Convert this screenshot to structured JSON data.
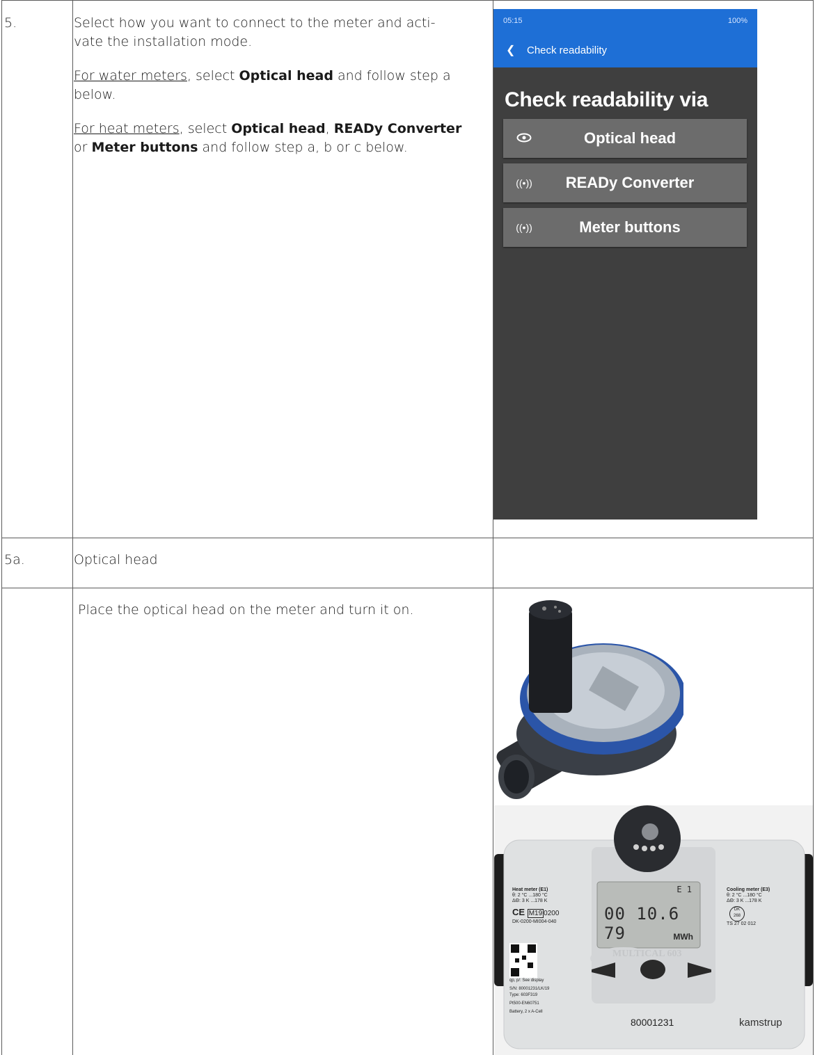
{
  "row5": {
    "number": "5.",
    "intro_line1": "Select how you want to connect to the meter and acti-",
    "intro_line2": "vate the installation mode.",
    "water": {
      "lead": "For water meters",
      "mid1": ", select ",
      "opt": "Optical head",
      "tail1": " and follow step a",
      "tail2": "below."
    },
    "heat": {
      "lead": "For heat meters",
      "mid1": ", select ",
      "opt1": "Optical head",
      "sep": ", ",
      "opt2": "READy Converter",
      "or": "or ",
      "opt3": "Meter buttons",
      "tail": " and follow step a, b or c below."
    }
  },
  "phone": {
    "status_time": "05:15",
    "status_right": "100%",
    "appbar_title": "Check readability",
    "heading": "Check readability via",
    "buttons": [
      {
        "label": "Optical head",
        "icon": "eye-icon"
      },
      {
        "label": "READy Converter",
        "icon": "radio-waves-icon"
      },
      {
        "label": "Meter buttons",
        "icon": "radio-waves-icon"
      }
    ]
  },
  "row5a": {
    "number": "5a.",
    "title": "Optical head"
  },
  "row_place": {
    "instruction": "Place the optical head on the meter and turn it on."
  },
  "meter_photo": {
    "left_title": "Heat meter (E1)",
    "left_l1": "θ: 2 °C ...180 °C",
    "left_l2": "ΔΘ: 3 K ...178 K",
    "ce_mark": "CE",
    "m_mark": "M19",
    "m_num": "0200",
    "approval": "DK-0200-MI004-040",
    "right_title": "Cooling meter (E3)",
    "right_l1": "θ: 2 °C ...180 °C",
    "right_l2": "ΔΘ: 3 K ...178 K",
    "dk": "DK",
    "dk_num": "268",
    "ts": "TS 27 02 012",
    "display_value": "00 10.6 79",
    "display_unit": "MWh",
    "display_e": "E 1",
    "model": "MULTICAL 603",
    "serial_big": "80001231",
    "qp": "qp, p/: See display",
    "sn": "S/N: 80001231/LK/19",
    "type": "Type: 603F319",
    "sensor": "Pt500-EN60751",
    "battery": "Battery, 2 x A-Cell",
    "brand": "kamstrup"
  }
}
